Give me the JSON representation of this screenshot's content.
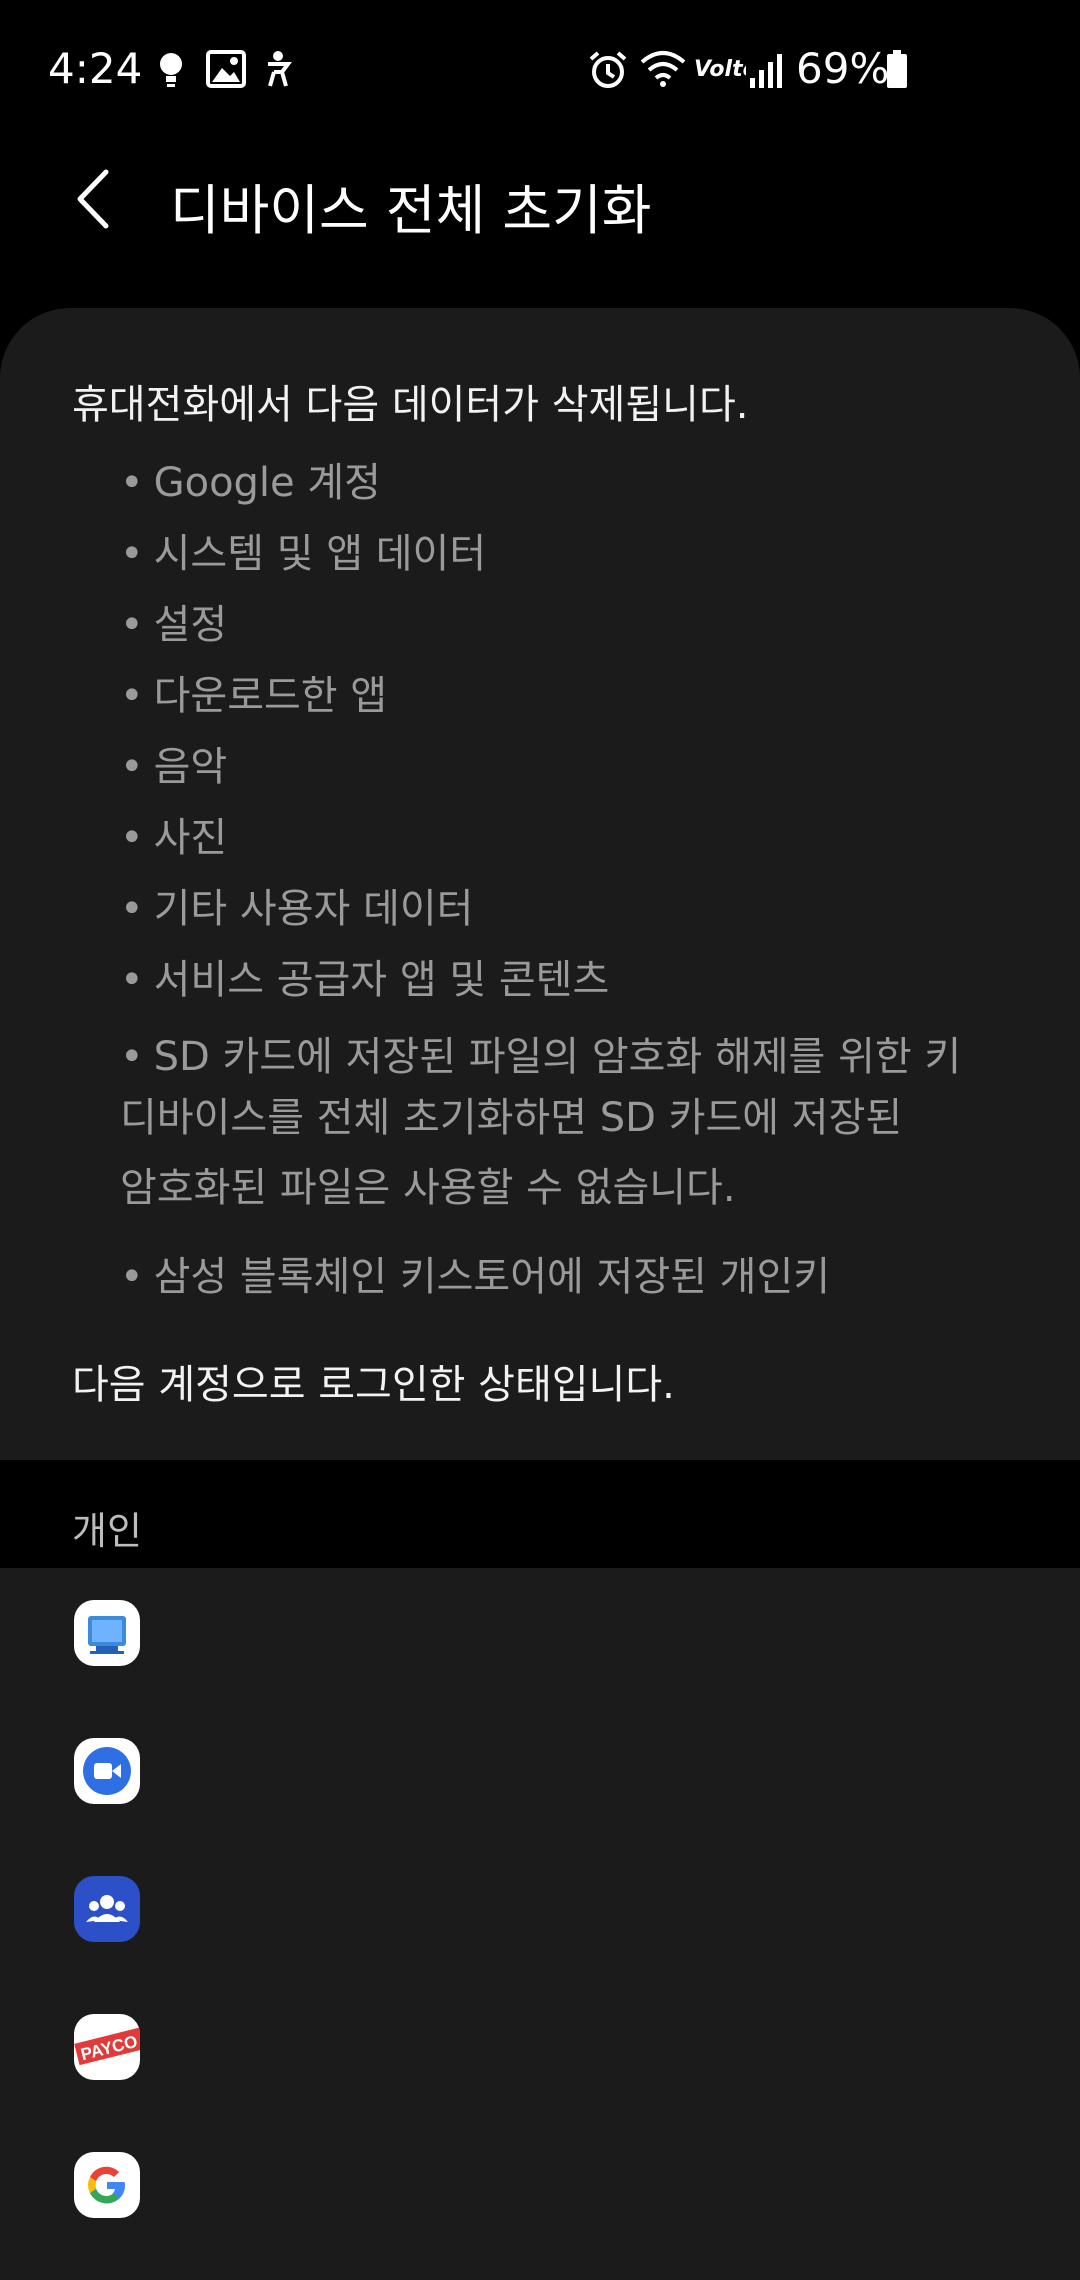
{
  "status_bar": {
    "time": "4:24",
    "battery": "69%",
    "icons": [
      "bulb-icon",
      "image-icon",
      "accessibility-icon",
      "alarm-icon",
      "wifi-icon",
      "volte-icon",
      "signal-icon",
      "battery-icon"
    ]
  },
  "header": {
    "back_icon": "back-arrow-icon",
    "title": "디바이스 전체 초기화"
  },
  "info": {
    "intro": "휴대전화에서 다음 데이터가 삭제됩니다.",
    "bullets": [
      "Google 계정",
      "시스템 및 앱 데이터",
      "설정",
      "다운로드한 앱",
      "음악",
      "사진",
      "기타 사용자 데이터",
      "서비스 공급자 앱 및 콘텐츠",
      "SD 카드에 저장된 파일의 암호화 해제를 위한 키"
    ],
    "sd_note_line1": "디바이스를 전체 초기화하면 SD 카드에 저장된",
    "sd_note_line2": "암호화된 파일은 사용할 수 없습니다.",
    "last_bullet": "삼성 블록체인 키스토어에 저장된 개인키",
    "accounts_intro": "다음 계정으로 로그인한 상태입니다."
  },
  "section": {
    "label": "개인"
  },
  "accounts": [
    {
      "icon": "samsung-account-icon",
      "color": "#2b6fd6"
    },
    {
      "icon": "google-duo-icon",
      "color": "#2f6fe4"
    },
    {
      "icon": "samsung-people-icon",
      "color": "#2b50c8"
    },
    {
      "icon": "payco-icon",
      "color": "#e03a3a"
    },
    {
      "icon": "google-icon",
      "color": "#ffffff"
    }
  ]
}
